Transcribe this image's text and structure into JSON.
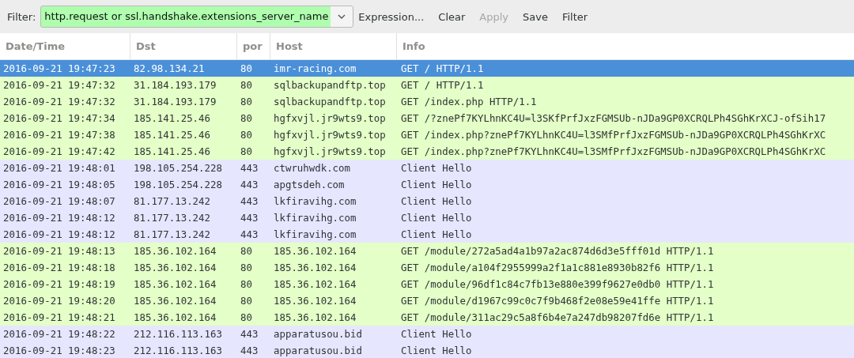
{
  "toolbar": {
    "filter_label": "Filter:",
    "filter_value": "http.request or ssl.handshake.extensions_server_name",
    "buttons": [
      {
        "label": "Expression...",
        "disabled": false
      },
      {
        "label": "Clear",
        "disabled": false
      },
      {
        "label": "Apply",
        "disabled": true
      },
      {
        "label": "Save",
        "disabled": false
      },
      {
        "label": "Filter",
        "disabled": false
      }
    ]
  },
  "table": {
    "columns": [
      "Date/Time",
      "Dst",
      "por",
      "Host",
      "Info"
    ],
    "rows": [
      {
        "kind": "http",
        "selected": true,
        "cells": [
          "2016-09-21 19:47:23",
          "82.98.134.21",
          "80",
          "imr-racing.com",
          "GET / HTTP/1.1"
        ]
      },
      {
        "kind": "http",
        "selected": false,
        "cells": [
          "2016-09-21 19:47:32",
          "31.184.193.179",
          "80",
          "sqlbackupandftp.top",
          "GET / HTTP/1.1"
        ]
      },
      {
        "kind": "http",
        "selected": false,
        "cells": [
          "2016-09-21 19:47:32",
          "31.184.193.179",
          "80",
          "sqlbackupandftp.top",
          "GET /index.php HTTP/1.1"
        ]
      },
      {
        "kind": "http",
        "selected": false,
        "cells": [
          "2016-09-21 19:47:34",
          "185.141.25.46",
          "80",
          "hgfxvjl.jr9wts9.top",
          "GET /?znePf7KYLhnKC4U=l3SKfPrfJxzFGMSUb-nJDa9GP0XCRQLPh4SGhKrXCJ-ofSih17"
        ]
      },
      {
        "kind": "http",
        "selected": false,
        "cells": [
          "2016-09-21 19:47:38",
          "185.141.25.46",
          "80",
          "hgfxvjl.jr9wts9.top",
          "GET /index.php?znePf7KYLhnKC4U=l3SMfPrfJxzFGMSUb-nJDa9GP0XCRQLPh4SGhKrXC"
        ]
      },
      {
        "kind": "http",
        "selected": false,
        "cells": [
          "2016-09-21 19:47:42",
          "185.141.25.46",
          "80",
          "hgfxvjl.jr9wts9.top",
          "GET /index.php?znePf7KYLhnKC4U=l3SMfPrfJxzFGMSUb-nJDa9GP0XCRQLPh4SGhKrXC"
        ]
      },
      {
        "kind": "tls",
        "selected": false,
        "cells": [
          "2016-09-21 19:48:01",
          "198.105.254.228",
          "443",
          "ctwruhwdk.com",
          "Client Hello"
        ]
      },
      {
        "kind": "tls",
        "selected": false,
        "cells": [
          "2016-09-21 19:48:05",
          "198.105.254.228",
          "443",
          "apgtsdeh.com",
          "Client Hello"
        ]
      },
      {
        "kind": "tls",
        "selected": false,
        "cells": [
          "2016-09-21 19:48:07",
          "81.177.13.242",
          "443",
          "lkfiravihg.com",
          "Client Hello"
        ]
      },
      {
        "kind": "tls",
        "selected": false,
        "cells": [
          "2016-09-21 19:48:12",
          "81.177.13.242",
          "443",
          "lkfiravihg.com",
          "Client Hello"
        ]
      },
      {
        "kind": "tls",
        "selected": false,
        "cells": [
          "2016-09-21 19:48:12",
          "81.177.13.242",
          "443",
          "lkfiravihg.com",
          "Client Hello"
        ]
      },
      {
        "kind": "http",
        "selected": false,
        "cells": [
          "2016-09-21 19:48:13",
          "185.36.102.164",
          "80",
          "185.36.102.164",
          "GET /module/272a5ad4a1b97a2ac874d6d3e5fff01d HTTP/1.1"
        ]
      },
      {
        "kind": "http",
        "selected": false,
        "cells": [
          "2016-09-21 19:48:18",
          "185.36.102.164",
          "80",
          "185.36.102.164",
          "GET /module/a104f2955999a2f1a1c881e8930b82f6 HTTP/1.1"
        ]
      },
      {
        "kind": "http",
        "selected": false,
        "cells": [
          "2016-09-21 19:48:19",
          "185.36.102.164",
          "80",
          "185.36.102.164",
          "GET /module/96df1c84c7fb13e880e399f9627e0db0 HTTP/1.1"
        ]
      },
      {
        "kind": "http",
        "selected": false,
        "cells": [
          "2016-09-21 19:48:20",
          "185.36.102.164",
          "80",
          "185.36.102.164",
          "GET /module/d1967c99c0c7f9b468f2e08e59e41ffe HTTP/1.1"
        ]
      },
      {
        "kind": "http",
        "selected": false,
        "cells": [
          "2016-09-21 19:48:21",
          "185.36.102.164",
          "80",
          "185.36.102.164",
          "GET /module/311ac29c5a8f6b4e7a247db98207fd6e HTTP/1.1"
        ]
      },
      {
        "kind": "tls",
        "selected": false,
        "cells": [
          "2016-09-21 19:48:22",
          "212.116.113.163",
          "443",
          "apparatusou.bid",
          "Client Hello"
        ]
      },
      {
        "kind": "tls",
        "selected": false,
        "cells": [
          "2016-09-21 19:48:23",
          "212.116.113.163",
          "443",
          "apparatusou.bid",
          "Client Hello"
        ]
      }
    ]
  }
}
